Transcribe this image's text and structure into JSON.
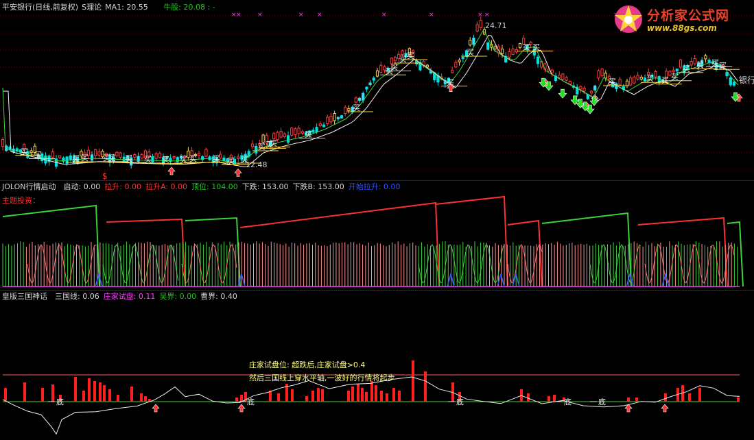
{
  "panel1": {
    "name": "平安银行(日线,前复权)",
    "indicator": "S理论",
    "ma_label": "MA1:",
    "ma_value": "20.55",
    "extra_label": "牛股:",
    "extra_value": "20.08",
    "extra_suffix": ": -",
    "high_label": "24.71",
    "low_label": "12.48",
    "right_label": "银行",
    "dollar": "$",
    "buy_text": "买",
    "cross_text": "×",
    "buy_markers": [
      30,
      50,
      105,
      118,
      150,
      158,
      182,
      210,
      236,
      262,
      276,
      310,
      331,
      351,
      376,
      387,
      393,
      444,
      514,
      562,
      569,
      582,
      593,
      651,
      680,
      762,
      776,
      887,
      942,
      964,
      978,
      995,
      1015,
      1037,
      1048
    ],
    "cross_markers": [
      337,
      344,
      375,
      435,
      462,
      556,
      625,
      696,
      706,
      894
    ]
  },
  "panel2": {
    "name": "JOLON行情启动",
    "fields": [
      {
        "label": "启动:",
        "value": "0.00",
        "color": "white"
      },
      {
        "label": "拉升:",
        "value": "0.00",
        "color": "red"
      },
      {
        "label": "拉升A:",
        "value": "0.00",
        "color": "red"
      },
      {
        "label": "顶位:",
        "value": "104.00",
        "color": "green"
      },
      {
        "label": "下跌:",
        "value": "153.00",
        "color": "white"
      },
      {
        "label": "下跌B:",
        "value": "153.00",
        "color": "white"
      },
      {
        "label": "开始拉升:",
        "value": "0.00",
        "color": "blue"
      }
    ],
    "subtitle": "主题投资："
  },
  "panel3": {
    "name": "皇版三国神话",
    "fields": [
      {
        "label": "三国线:",
        "value": "0.06",
        "color": "white"
      },
      {
        "label": "庄家试盘:",
        "value": "0.11",
        "color": "magenta"
      },
      {
        "label": "吴界:",
        "value": "0.00",
        "color": "green"
      },
      {
        "label": "曹界:",
        "value": "0.40",
        "color": "white"
      }
    ],
    "bottom_text": "底",
    "bottom_markers": [
      82,
      360,
      665,
      822,
      872
    ],
    "note_line1": "庄家试盘位: 超跌后,庄家试盘>0.4",
    "note_line2": "然后三国线上穿水平轴,一波好的行情将起步"
  },
  "logo": {
    "title": "分析家公式网",
    "url": "www.88gs.com"
  },
  "chart_data": {
    "type": "candlestick",
    "price_range": [
      12.48,
      24.71
    ],
    "moving_average": {
      "name": "MA1",
      "last": 20.55
    },
    "up_arrow_markers": [
      250,
      347,
      657,
      795,
      855,
      867,
      1077
    ]
  }
}
